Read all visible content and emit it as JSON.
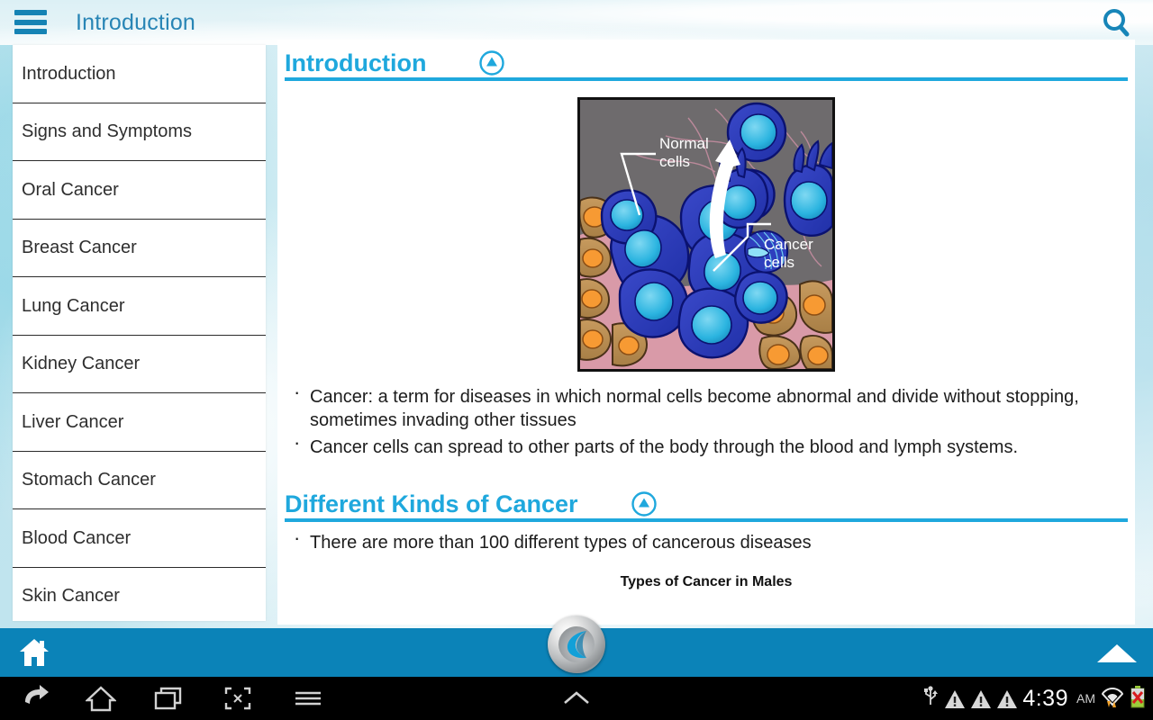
{
  "header": {
    "title": "Introduction",
    "menu_icon": "hamburger-menu-icon",
    "search_icon": "search-icon"
  },
  "sidebar": {
    "items": [
      {
        "label": "Introduction"
      },
      {
        "label": "Signs and Symptoms"
      },
      {
        "label": "Oral Cancer"
      },
      {
        "label": "Breast Cancer"
      },
      {
        "label": "Lung Cancer"
      },
      {
        "label": "Kidney Cancer"
      },
      {
        "label": "Liver Cancer"
      },
      {
        "label": "Stomach Cancer"
      },
      {
        "label": "Blood Cancer"
      },
      {
        "label": "Skin Cancer"
      }
    ]
  },
  "content": {
    "sections": [
      {
        "title": "Introduction",
        "collapse_icon": "collapse-up-icon",
        "figure": {
          "alt": "diagram of normal cells and cancer cells",
          "labels": {
            "normal_cells": "Normal\ncells",
            "normal_cells_line1": "Normal",
            "normal_cells_line2": "cells",
            "cancer_cells_line1": "Cancer",
            "cancer_cells_line2": "cells"
          }
        },
        "bullets": [
          "Cancer: a term for diseases in which normal cells become abnormal and divide without stopping, sometimes invading other tissues",
          "Cancer cells can spread to other parts of the body through the blood and lymph systems."
        ]
      },
      {
        "title": "Different Kinds of Cancer",
        "collapse_icon": "collapse-up-icon",
        "bullets": [
          "There are more than 100 different types of cancerous diseases"
        ],
        "caption": "Types of Cancer in Males"
      }
    ]
  },
  "bottom_bar": {
    "home_icon": "home-icon",
    "logo_icon": "app-logo-icon",
    "scroll_top_icon": "scroll-to-top-icon"
  },
  "navbar": {
    "back_icon": "back-icon",
    "home_icon": "home-icon",
    "recents_icon": "recent-apps-icon",
    "screenshot_icon": "screenshot-icon",
    "menu_icon": "menu-icon",
    "collapse_icon": "collapse-keyboard-icon",
    "status": {
      "usb_icon": "usb-icon",
      "warning_icons": [
        "warning-triangle-icon",
        "warning-triangle-icon",
        "warning-triangle-icon"
      ],
      "time": "4:39",
      "meridiem": "AM",
      "wifi_icon": "wifi-icon",
      "battery_icon": "battery-error-icon"
    }
  },
  "colors": {
    "accent_blue": "#1fa8dd",
    "header_text": "#2885b5",
    "bottom_bar": "#0b83b8",
    "hamburger": "#1583b4"
  }
}
